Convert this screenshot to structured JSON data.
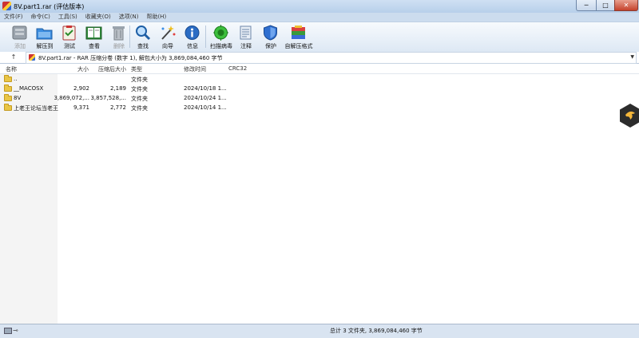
{
  "window": {
    "title": "8V.part1.rar (评估版本)"
  },
  "window_controls": {
    "minimize": "─",
    "maximize": "□",
    "close": "✕"
  },
  "menu": [
    "文件(F)",
    "命令(C)",
    "工具(S)",
    "收藏夹(O)",
    "选项(N)",
    "帮助(H)"
  ],
  "toolbar": {
    "add": "添加",
    "extract": "解压到",
    "test": "测试",
    "view": "查看",
    "delete": "删除",
    "find": "查找",
    "wizard": "向导",
    "info": "信息",
    "virus_scan": "扫描病毒",
    "comment": "注释",
    "protect": "保护",
    "sfx": "自解压格式"
  },
  "address": {
    "up": "↑",
    "path": "8V.part1.rar - RAR 压缩分卷 (数字 1), 解包大小为 3,869,084,460 字节",
    "dropdown": "▼"
  },
  "columns": {
    "name": "名称",
    "size": "大小",
    "packed": "压缩后大小",
    "type": "类型",
    "modified": "修改时间",
    "crc": "CRC32"
  },
  "files": [
    {
      "name": "..",
      "size": "",
      "packed": "",
      "type": "文件夹",
      "modified": ""
    },
    {
      "name": "__MACOSX",
      "size": "2,902",
      "packed": "2,189",
      "type": "文件夹",
      "modified": "2024/10/18 1..."
    },
    {
      "name": "8V",
      "size": "3,869,072,...",
      "packed": "3,857,528,...",
      "type": "文件夹",
      "modified": "2024/10/24 1..."
    },
    {
      "name": "上老王论坛当老王",
      "size": "9,371",
      "packed": "2,772",
      "type": "文件夹",
      "modified": "2024/10/14 1..."
    }
  ],
  "status": {
    "summary": "总计 3 文件夹, 3,869,084,460 字节",
    "key_icon": "⊸"
  },
  "colors": {
    "titlebar": "#b7cfea",
    "window_bg": "#b9d1ea",
    "folder": "#e9c545"
  }
}
